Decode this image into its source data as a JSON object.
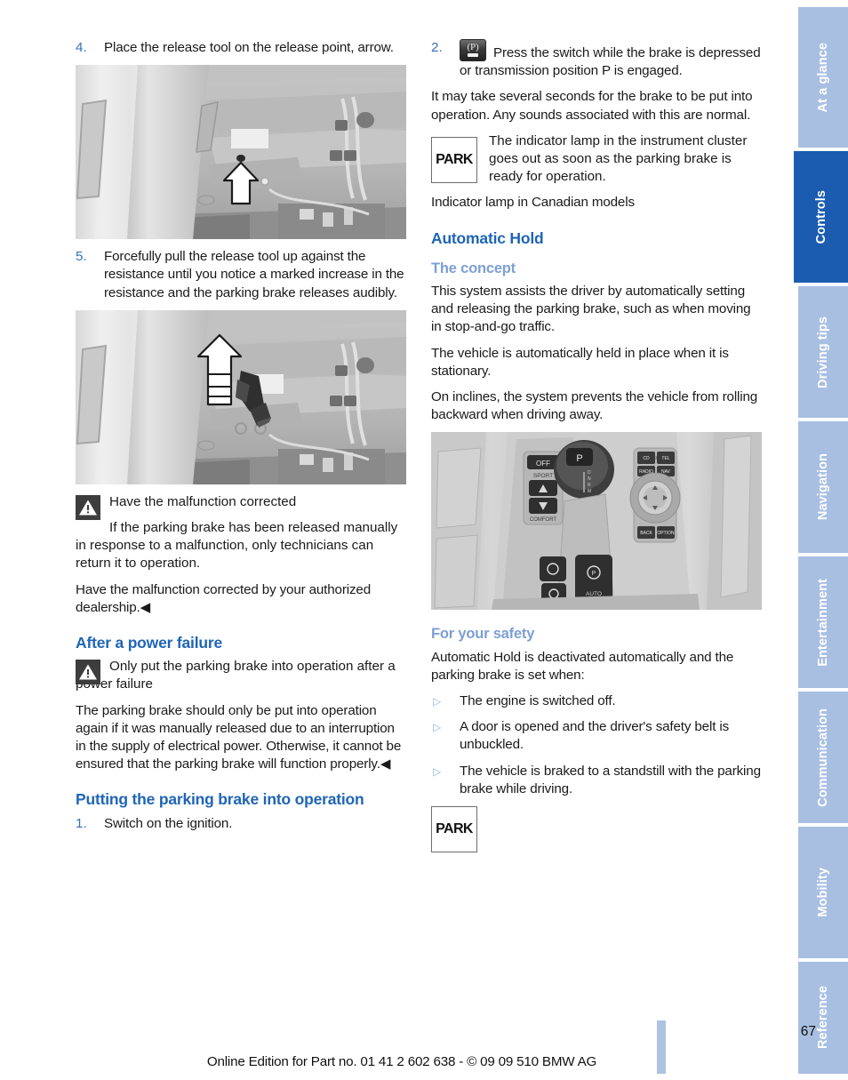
{
  "document": {
    "page_number": "67",
    "footer": "Online Edition for Part no. 01 41 2 602 638 - © 09 09 510 BMW AG"
  },
  "colors": {
    "heading_main": "#1f65b7",
    "heading_sub": "#7d9fd4",
    "step_number": "#3772b8",
    "tab_inactive": "#a8bfe2",
    "tab_active": "#1b5cb0",
    "bullet_marker": "#96b4de"
  },
  "left_column": {
    "step4": {
      "number": "4.",
      "text": "Place the release tool on the release point, arrow."
    },
    "figure_release_point": {
      "caption": "",
      "alt": "footwell-release-point-illustration"
    },
    "step5": {
      "number": "5.",
      "text": "Forcefully pull the release tool up against the resistance until you notice a marked increase in the resistance and the parking brake releases audibly."
    },
    "figure_release_tool": {
      "caption": "",
      "alt": "footwell-release-tool-illustration"
    },
    "warning1": {
      "title": "Have the malfunction corrected",
      "body": "If the parking brake has been released manually in response to a malfunction, only technicians can return it to operation."
    },
    "para_authorized": "Have the malfunction corrected by your authorized dealership.◀",
    "heading_power_failure": "After a power failure",
    "warning2": {
      "title": "Only put the parking brake into operation after a power failure"
    },
    "para_power_failure": "The parking brake should only be put into operation again if it was manually released due to an interruption in the supply of electrical power. Otherwise, it cannot be ensured that the parking brake will function properly.◀",
    "heading_putting_into_operation": "Putting the parking brake into operation",
    "step1": {
      "number": "1.",
      "text": "Switch on the ignition."
    }
  },
  "right_column": {
    "step2": {
      "number": "2.",
      "icon": "parking-brake-switch-icon",
      "icon_label": "(P)",
      "text": "Press the switch while the brake is depressed or transmission position P is engaged."
    },
    "para_seconds": "It may take several seconds for the brake to be put into operation. Any sounds associated with this are normal.",
    "lamp_note": {
      "lamp_label": "PARK",
      "text": "The indicator lamp in the instrument cluster goes out as soon as the parking brake is ready for operation."
    },
    "para_canadian": "Indicator lamp in Canadian models",
    "heading_automatic_hold": "Automatic Hold",
    "heading_the_concept": "The concept",
    "para_concept1": "This system assists the driver by automatically setting and releasing the parking brake, such as when moving in stop-and-go traffic.",
    "para_concept2": "The vehicle is automatically held in place when it is stationary.",
    "para_concept3": "On inclines, the system prevents the vehicle from rolling backward when driving away.",
    "figure_console": {
      "caption": "",
      "alt": "center-console-illustration"
    },
    "heading_for_your_safety": "For your safety",
    "para_safety_intro": "Automatic Hold is deactivated automatically and the parking brake is set when:",
    "safety_bullets": [
      "The engine is switched off.",
      "A door is opened and the driver's safety belt is unbuckled.",
      "The vehicle is braked to a standstill with the parking brake while driving."
    ],
    "bullet_marker": "▷",
    "park_lamp_bottom": "PARK"
  },
  "side_tabs": [
    {
      "label": "At a glance",
      "active": false
    },
    {
      "label": "Controls",
      "active": true
    },
    {
      "label": "Driving tips",
      "active": false
    },
    {
      "label": "Navigation",
      "active": false
    },
    {
      "label": "Entertainment",
      "active": false
    },
    {
      "label": "Communication",
      "active": false
    },
    {
      "label": "Mobility",
      "active": false
    },
    {
      "label": "Reference",
      "active": false
    }
  ]
}
